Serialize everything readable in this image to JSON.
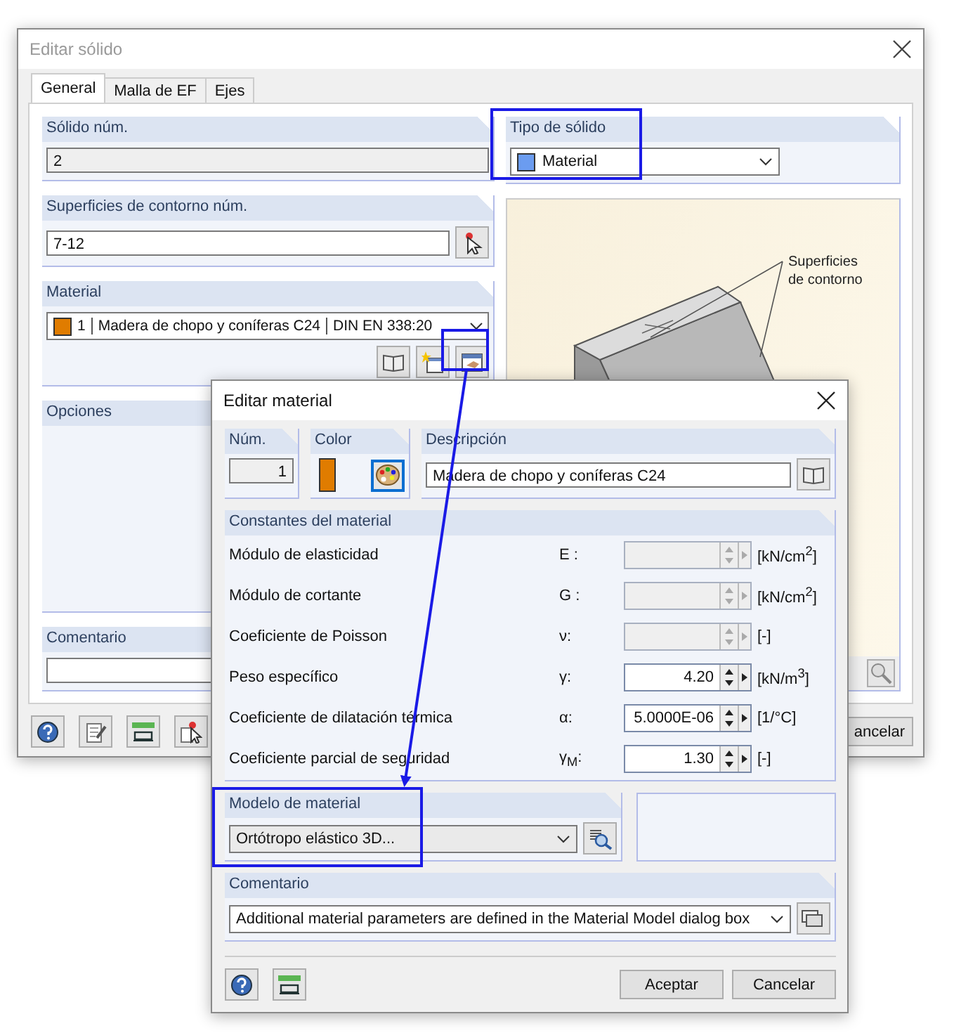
{
  "solid_dialog": {
    "title": "Editar sólido",
    "tabs": [
      {
        "label": "General",
        "selected": true
      },
      {
        "label": "Malla de EF",
        "selected": false
      },
      {
        "label": "Ejes",
        "selected": false
      }
    ],
    "solid_number": {
      "label": "Sólido núm.",
      "value": "2"
    },
    "solid_type": {
      "label": "Tipo de sólido",
      "value": "Material",
      "color": "#6b9cf0"
    },
    "boundary_surfaces": {
      "label": "Superficies de contorno núm.",
      "value": "7-12"
    },
    "material": {
      "label": "Material",
      "color": "#e07c00",
      "number": "1",
      "name": "Madera de chopo y coníferas C24",
      "standard": "DIN EN 338:20"
    },
    "options": {
      "label": "Opciones"
    },
    "comment": {
      "label": "Comentario"
    },
    "figure": {
      "callout": "Superficies de contorno"
    },
    "cancel_button": "ancelar"
  },
  "material_dialog": {
    "title": "Editar material",
    "number": {
      "label": "Núm.",
      "value": "1"
    },
    "color": {
      "label": "Color",
      "color": "#e07c00"
    },
    "description": {
      "label": "Descripción",
      "value": "Madera de chopo y coníferas C24"
    },
    "constants": {
      "title": "Constantes del material",
      "rows": [
        {
          "label": "Módulo de elasticidad",
          "symbol": "E :",
          "unit": "[kN/cm$^{2}$]",
          "disabled": true
        },
        {
          "label": "Módulo de cortante",
          "symbol": "G :",
          "unit": "[kN/cm$^{2}$]",
          "disabled": true
        },
        {
          "label": "Coeficiente de Poisson",
          "symbol": "ν:",
          "unit": "[-]",
          "disabled": true
        },
        {
          "label": "Peso específico",
          "symbol": "γ:",
          "value": "4.20",
          "unit": "[kN/m$^{3}$]",
          "disabled": false
        },
        {
          "label": "Coeficiente de dilatación térmica",
          "symbol": "α:",
          "value": "5.0000E-06",
          "unit": "[1/°C]",
          "disabled": false
        },
        {
          "label": "Coeficiente parcial de seguridad",
          "symbol": "γ$_{M}$:",
          "value": "1.30",
          "unit": "[-]",
          "disabled": false
        }
      ]
    },
    "model": {
      "label": "Modelo de material",
      "value": "Ortótropo elástico 3D..."
    },
    "comment": {
      "label": "Comentario",
      "value": "Additional material parameters are defined in the Material Model dialog box"
    },
    "buttons": [
      "Aceptar",
      "Cancelar"
    ]
  }
}
